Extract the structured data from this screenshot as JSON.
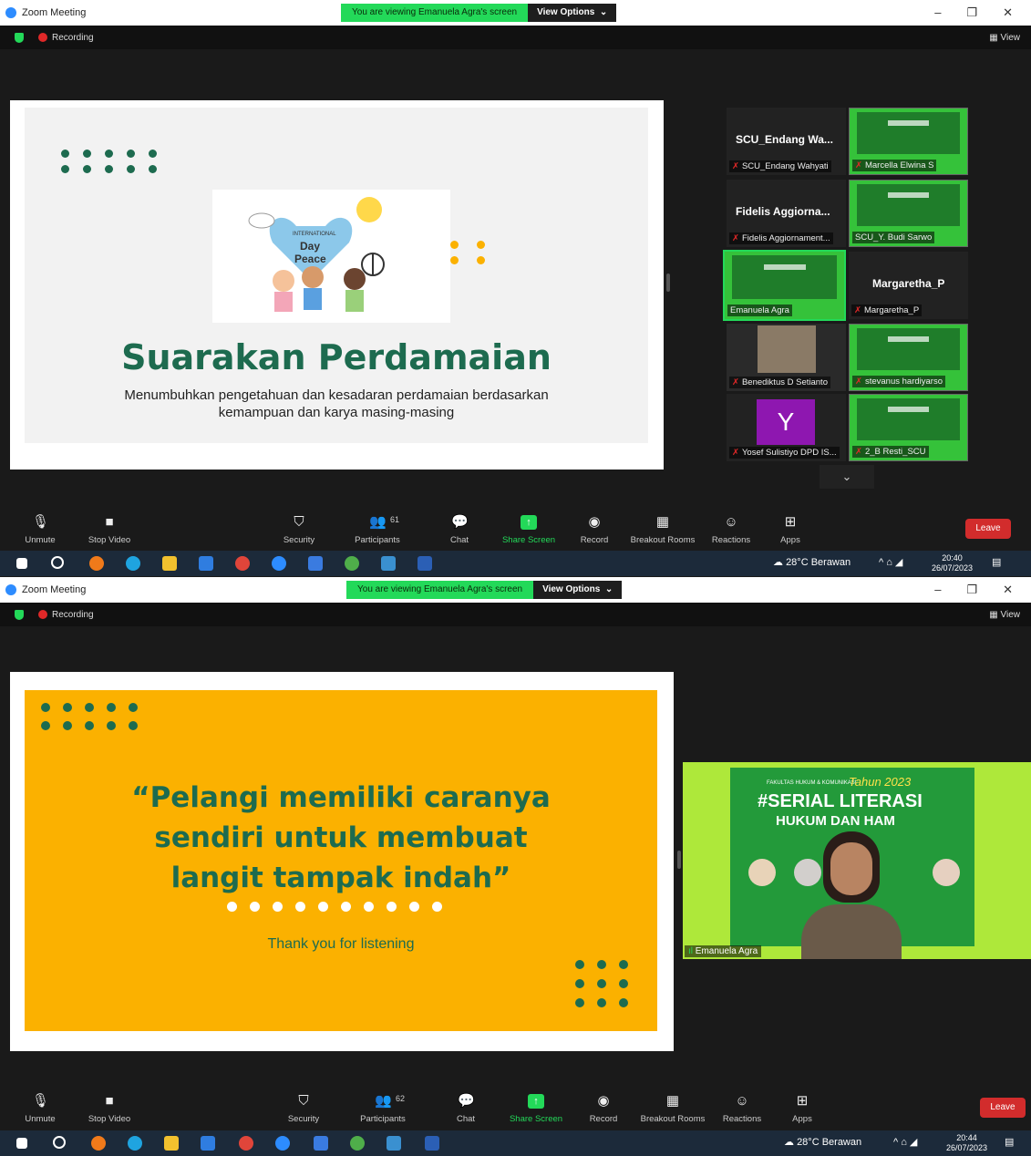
{
  "app": {
    "title": "Zoom Meeting"
  },
  "windows": [
    {
      "banner_text": "You are viewing Emanuela Agra's screen",
      "banner_options": "View Options",
      "recording_label": "Recording",
      "view_label": "View",
      "slide": {
        "title": "Suarakan Perdamaian",
        "subtitle_line1": "Menumbuhkan pengetahuan dan kesadaran perdamaian berdasarkan",
        "subtitle_line2": "kemampuan dan karya masing-masing",
        "graphic_text_top": "INTERNATIONAL",
        "graphic_text_mid": "Day",
        "graphic_text_bottom": "Peace"
      },
      "participants_tiles": [
        {
          "name_big": "SCU_Endang Wa...",
          "label": "SCU_Endang Wahyati",
          "muted": true,
          "kind": "name"
        },
        {
          "label": "Marcella Elwina S",
          "muted": true,
          "kind": "video",
          "poster": "#SERIAL LITERASI HUKUM DAN HAM"
        },
        {
          "name_big": "Fidelis Aggiorna...",
          "label": "Fidelis Aggiornament...",
          "muted": true,
          "kind": "name"
        },
        {
          "label": "SCU_Y. Budi Sarwo",
          "muted": false,
          "kind": "video",
          "poster": "#SERIAL LITERASI HUKUM"
        },
        {
          "label": "Emanuela Agra",
          "muted": false,
          "kind": "video-active",
          "poster": "#SERIAL LITERASI HUKUM"
        },
        {
          "name_big": "Margaretha_P",
          "label": "Margaretha_P",
          "muted": true,
          "kind": "name"
        },
        {
          "label": "Benediktus D Setianto",
          "muted": true,
          "kind": "photo"
        },
        {
          "label": "stevanus hardiyarso",
          "muted": true,
          "kind": "video",
          "poster": "#SERIAL LITERASI"
        },
        {
          "letter": "Y",
          "label": "Yosef Sulistiyo DPD IS...",
          "muted": true,
          "kind": "letter"
        },
        {
          "label": "2_B Resti_SCU",
          "muted": true,
          "kind": "video",
          "poster": "#SERIAL LITERASI HUKUM DAN HAM"
        }
      ],
      "toolbar": {
        "unmute": "Unmute",
        "stop_video": "Stop Video",
        "security": "Security",
        "participants": "Participants",
        "participants_count": "61",
        "chat": "Chat",
        "share_screen": "Share Screen",
        "record": "Record",
        "breakout": "Breakout Rooms",
        "reactions": "Reactions",
        "apps": "Apps",
        "leave": "Leave"
      },
      "taskbar": {
        "weather": "28°C  Berawan",
        "time": "20:40",
        "date": "26/07/2023"
      }
    },
    {
      "banner_text": "You are viewing Emanuela Agra's screen",
      "banner_options": "View Options",
      "recording_label": "Recording",
      "view_label": "View",
      "slide": {
        "quote_line1": "“Pelangi memiliki caranya",
        "quote_line2": "sendiri untuk membuat",
        "quote_line3": "langit tampak indah”",
        "thanks": "Thank you for listening"
      },
      "speaker": {
        "label": "Emanuela Agra",
        "poster_line1": "FAKULTAS HUKUM & KOMUNIKASI",
        "poster_year": "Tahun 2023",
        "poster_line2": "#SERIAL LITERASI",
        "poster_line3": "HUKUM DAN HAM"
      },
      "toolbar": {
        "unmute": "Unmute",
        "stop_video": "Stop Video",
        "security": "Security",
        "participants": "Participants",
        "participants_count": "62",
        "chat": "Chat",
        "share_screen": "Share Screen",
        "record": "Record",
        "breakout": "Breakout Rooms",
        "reactions": "Reactions",
        "apps": "Apps",
        "leave": "Leave"
      },
      "taskbar": {
        "weather": "28°C  Berawan",
        "time": "20:44",
        "date": "26/07/2023"
      }
    }
  ],
  "colors": {
    "share_green": "#23d959",
    "slide_green": "#1d6b4f",
    "slide_yellow": "#fbb100",
    "slide_yellow_text": "#1d6b4f",
    "leave_red": "#d22c2c",
    "tile_green": "#35c23a"
  }
}
